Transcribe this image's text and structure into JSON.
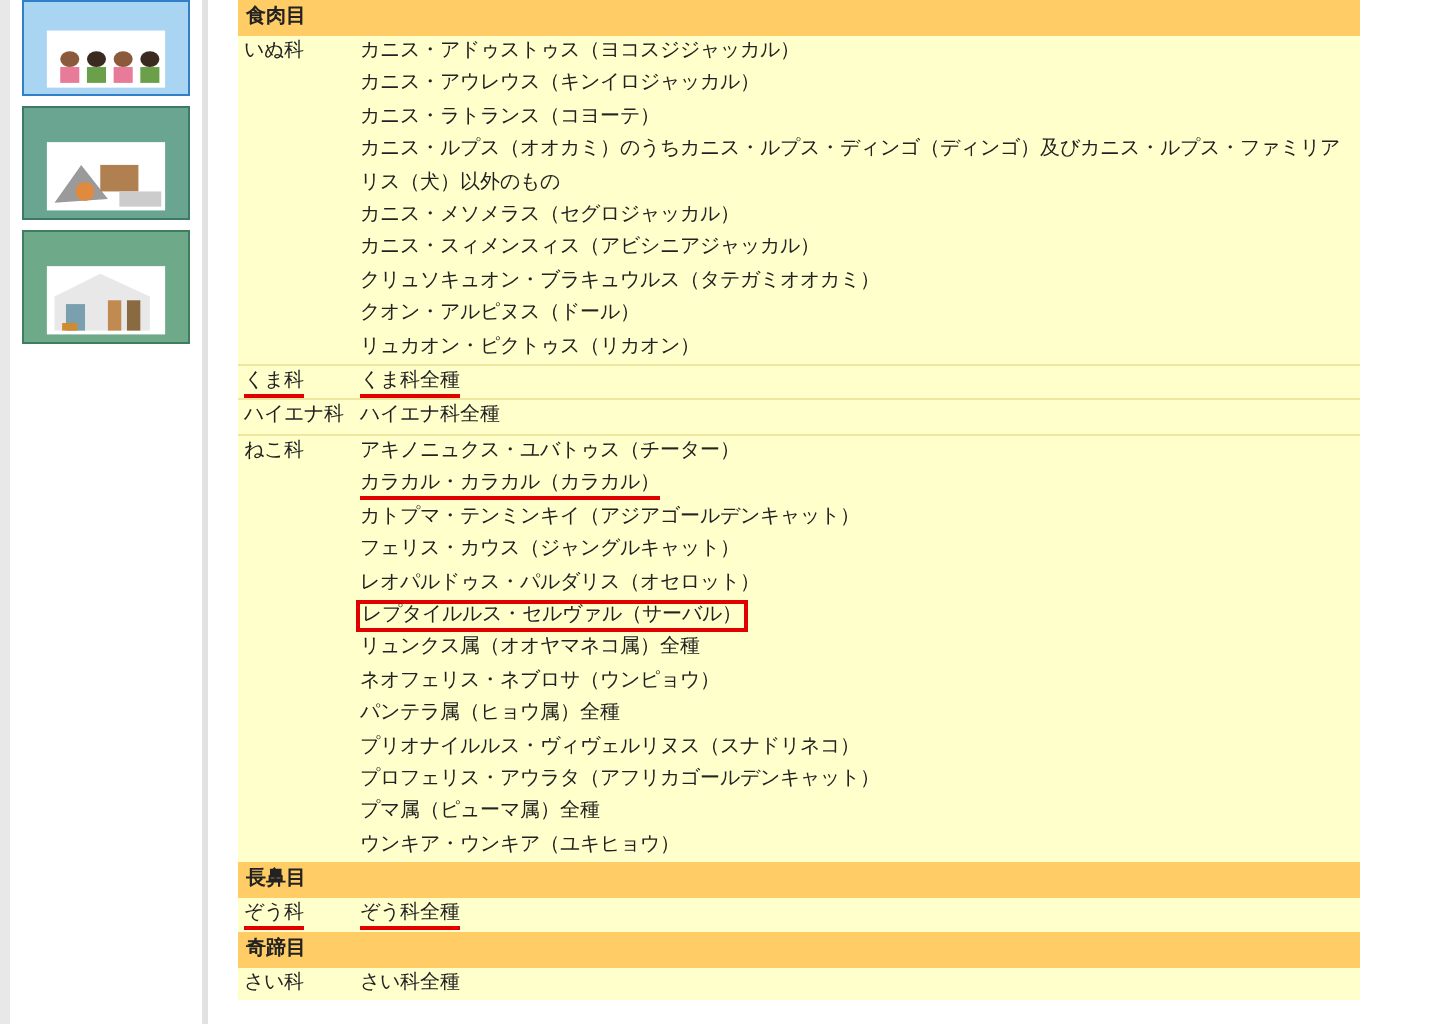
{
  "orders": [
    {
      "name": "食肉目",
      "families": [
        {
          "name": "いぬ科",
          "underlined": false,
          "species": [
            {
              "name": "カニス・アドゥストゥス（ヨコスジジャッカル）",
              "underlined": false,
              "boxed": false
            },
            {
              "name": "カニス・アウレウス（キンイロジャッカル）",
              "underlined": false,
              "boxed": false
            },
            {
              "name": "カニス・ラトランス（コヨーテ）",
              "underlined": false,
              "boxed": false
            },
            {
              "name": "カニス・ルプス（オオカミ）のうちカニス・ルプス・ディンゴ（ディンゴ）及びカニス・ルプス・ファミリアリス（犬）以外のもの",
              "underlined": false,
              "boxed": false
            },
            {
              "name": "カニス・メソメラス（セグロジャッカル）",
              "underlined": false,
              "boxed": false
            },
            {
              "name": "カニス・スィメンスィス（アビシニアジャッカル）",
              "underlined": false,
              "boxed": false
            },
            {
              "name": "クリュソキュオン・ブラキュウルス（タテガミオオカミ）",
              "underlined": false,
              "boxed": false
            },
            {
              "name": "クオン・アルピヌス（ドール）",
              "underlined": false,
              "boxed": false
            },
            {
              "name": "リュカオン・ピクトゥス（リカオン）",
              "underlined": false,
              "boxed": false
            }
          ]
        },
        {
          "name": "くま科",
          "underlined": true,
          "species": [
            {
              "name": "くま科全種",
              "underlined": true,
              "boxed": false
            }
          ]
        },
        {
          "name": "ハイエナ科",
          "underlined": false,
          "species": [
            {
              "name": "ハイエナ科全種",
              "underlined": false,
              "boxed": false
            }
          ]
        },
        {
          "name": "ねこ科",
          "underlined": false,
          "species": [
            {
              "name": "アキノニュクス・ユバトゥス（チーター）",
              "underlined": false,
              "boxed": false
            },
            {
              "name": "カラカル・カラカル（カラカル）",
              "underlined": true,
              "boxed": false
            },
            {
              "name": "カトプマ・テンミンキイ（アジアゴールデンキャット）",
              "underlined": false,
              "boxed": false
            },
            {
              "name": "フェリス・カウス（ジャングルキャット）",
              "underlined": false,
              "boxed": false
            },
            {
              "name": "レオパルドゥス・パルダリス（オセロット）",
              "underlined": false,
              "boxed": false
            },
            {
              "name": "レプタイルルス・セルヴァル（サーバル）",
              "underlined": false,
              "boxed": true
            },
            {
              "name": "リュンクス属（オオヤマネコ属）全種",
              "underlined": false,
              "boxed": false
            },
            {
              "name": "ネオフェリス・ネブロサ（ウンピョウ）",
              "underlined": false,
              "boxed": false
            },
            {
              "name": "パンテラ属（ヒョウ属）全種",
              "underlined": false,
              "boxed": false
            },
            {
              "name": "プリオナイルルス・ヴィヴェルリヌス（スナドリネコ）",
              "underlined": false,
              "boxed": false
            },
            {
              "name": "プロフェリス・アウラタ（アフリカゴールデンキャット）",
              "underlined": false,
              "boxed": false
            },
            {
              "name": "プマ属（ピューマ属）全種",
              "underlined": false,
              "boxed": false
            },
            {
              "name": "ウンキア・ウンキア（ユキヒョウ）",
              "underlined": false,
              "boxed": false
            }
          ]
        }
      ]
    },
    {
      "name": "長鼻目",
      "families": [
        {
          "name": "ぞう科",
          "underlined": true,
          "species": [
            {
              "name": "ぞう科全種",
              "underlined": true,
              "boxed": false
            }
          ]
        }
      ]
    },
    {
      "name": "奇蹄目",
      "families": [
        {
          "name": "さい科",
          "underlined": false,
          "species": [
            {
              "name": "さい科全種",
              "underlined": false,
              "boxed": false
            }
          ]
        }
      ]
    }
  ]
}
